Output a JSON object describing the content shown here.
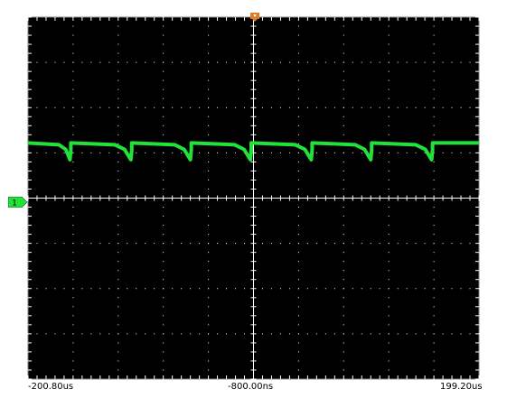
{
  "scope": {
    "screen_bg": "#000000",
    "grid_color": "#ffffff",
    "trace_color": "#22e23a",
    "channel_marker": {
      "label": "1",
      "fill": "#22e23a",
      "icon": "channel-1-ground-marker"
    },
    "trigger_marker": {
      "icon": "trigger-position-marker",
      "fill": "#e07a1e"
    },
    "time_labels": {
      "left": "-200.80us",
      "center": "-800.00ns",
      "right": "199.20us"
    },
    "grid": {
      "horizontal_divisions": 10,
      "vertical_divisions": 8
    },
    "waveform": {
      "pulse_start_times_div": [
        0.95,
        2.3,
        3.62,
        4.95,
        6.3,
        7.62,
        8.97
      ],
      "baseline_div_above_center": 1.2,
      "dip_depth_div": 0.35
    }
  }
}
